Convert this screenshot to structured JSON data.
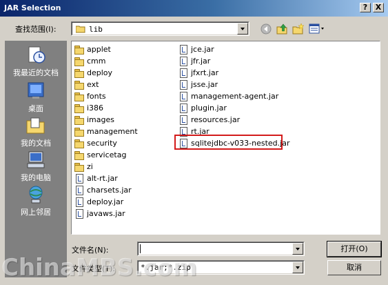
{
  "window": {
    "title": "JAR Selection",
    "help_btn": "?",
    "close_btn": "X"
  },
  "lookin": {
    "label": "查找范围(I):",
    "value": "lib"
  },
  "places": [
    {
      "label": "我最近的文档",
      "icon": "recent-documents-icon"
    },
    {
      "label": "桌面",
      "icon": "desktop-icon"
    },
    {
      "label": "我的文档",
      "icon": "my-documents-icon"
    },
    {
      "label": "我的电脑",
      "icon": "my-computer-icon"
    },
    {
      "label": "网上邻居",
      "icon": "network-places-icon"
    }
  ],
  "files": {
    "col1": [
      {
        "name": "applet",
        "type": "folder"
      },
      {
        "name": "cmm",
        "type": "folder"
      },
      {
        "name": "deploy",
        "type": "folder"
      },
      {
        "name": "ext",
        "type": "folder"
      },
      {
        "name": "fonts",
        "type": "folder"
      },
      {
        "name": "i386",
        "type": "folder"
      },
      {
        "name": "images",
        "type": "folder"
      },
      {
        "name": "management",
        "type": "folder"
      },
      {
        "name": "security",
        "type": "folder"
      },
      {
        "name": "servicetag",
        "type": "folder"
      },
      {
        "name": "zi",
        "type": "folder"
      },
      {
        "name": "alt-rt.jar",
        "type": "jar"
      },
      {
        "name": "charsets.jar",
        "type": "jar"
      },
      {
        "name": "deploy.jar",
        "type": "jar"
      },
      {
        "name": "javaws.jar",
        "type": "jar"
      }
    ],
    "col2": [
      {
        "name": "jce.jar",
        "type": "jar"
      },
      {
        "name": "jfr.jar",
        "type": "jar"
      },
      {
        "name": "jfxrt.jar",
        "type": "jar"
      },
      {
        "name": "jsse.jar",
        "type": "jar"
      },
      {
        "name": "management-agent.jar",
        "type": "jar"
      },
      {
        "name": "plugin.jar",
        "type": "jar"
      },
      {
        "name": "resources.jar",
        "type": "jar"
      },
      {
        "name": "rt.jar",
        "type": "jar"
      },
      {
        "name": "sqlitejdbc-v033-nested.jar",
        "type": "jar"
      }
    ]
  },
  "filename": {
    "label": "文件名(N):",
    "value": ""
  },
  "filetype": {
    "label": "文件类型(T):",
    "value": "*.jar;*.zip"
  },
  "buttons": {
    "open": "打开(O)",
    "cancel": "取消"
  },
  "watermark": "ChinaMBS.com"
}
